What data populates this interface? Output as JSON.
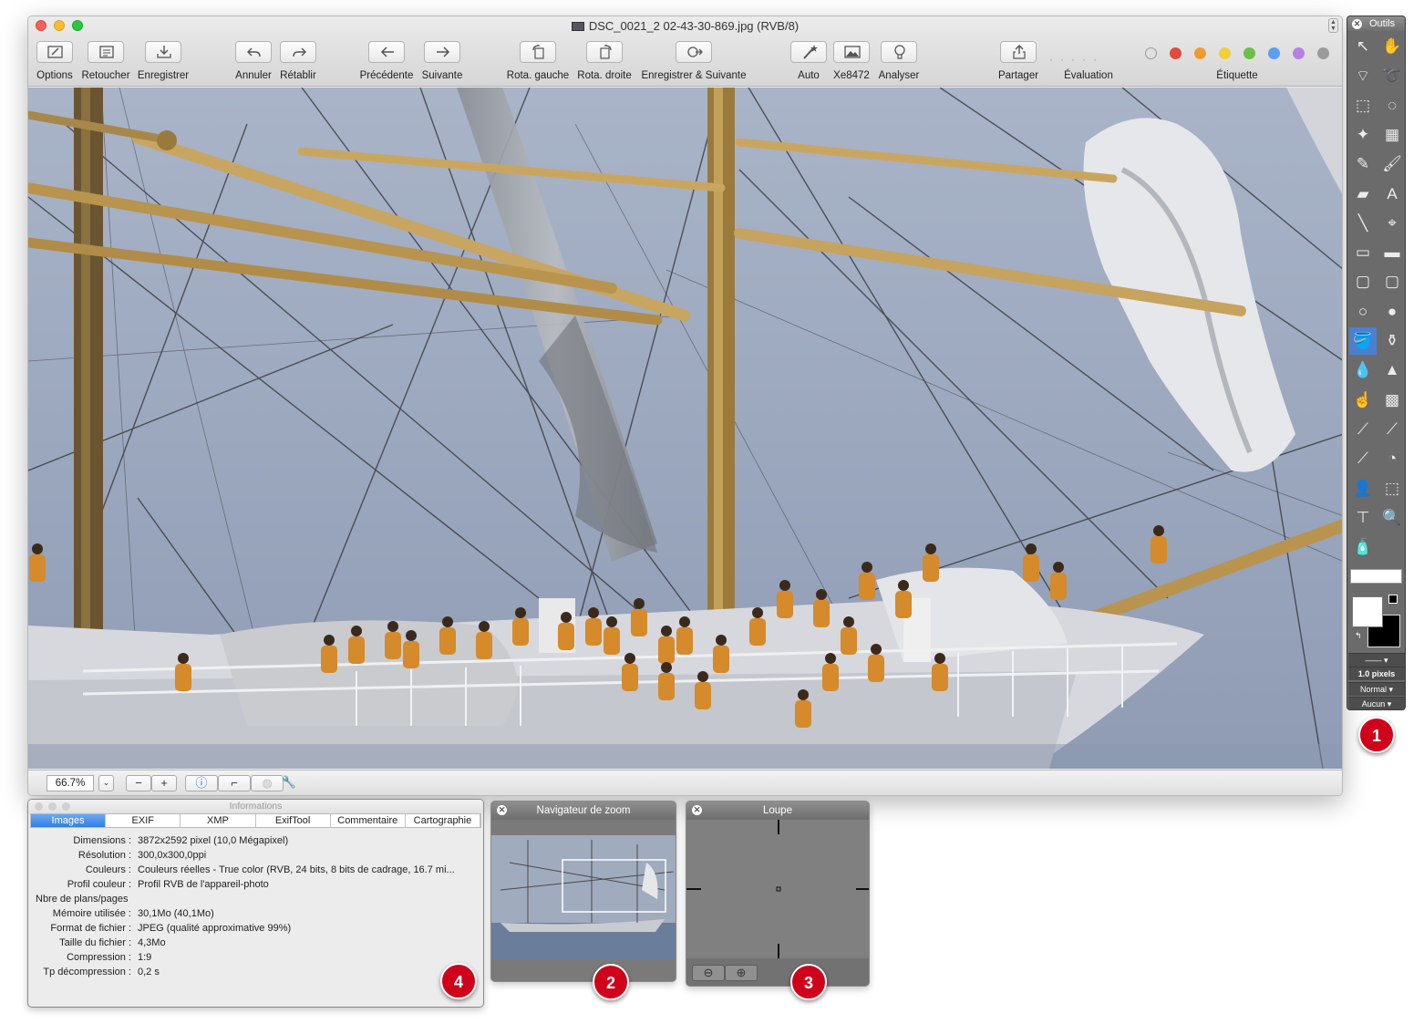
{
  "window": {
    "title": "DSC_0021_2 02-43-30-869.jpg (RVB/8)"
  },
  "toolbar": {
    "options": "Options",
    "retoucher": "Retoucher",
    "enregistrer": "Enregistrer",
    "annuler": "Annuler",
    "retablir": "Rétablir",
    "precedente": "Précédente",
    "suivante": "Suivante",
    "rota_gauche": "Rota. gauche",
    "rota_droite": "Rota. droite",
    "enregistrer_suivante": "Enregistrer & Suivante",
    "auto": "Auto",
    "xe": "Xe8472",
    "analyser": "Analyser",
    "partager": "Partager",
    "evaluation": "Évaluation",
    "etiquette": "Étiquette",
    "label_colors": [
      "#e24b3b",
      "#f09a33",
      "#f0cf3a",
      "#6cc04a",
      "#5b9ff0",
      "#b77fe0",
      "#9b9b9b"
    ]
  },
  "statusbar": {
    "zoom": "66.7%",
    "minus": "−",
    "plus": "+"
  },
  "tools_palette": {
    "title": "Outils",
    "stroke_size": "1.0 pixels",
    "blend_mode": "Normal",
    "texture": "Aucun"
  },
  "info_panel": {
    "title": "Informations",
    "tabs": [
      "Images",
      "EXIF",
      "XMP",
      "ExifTool",
      "Commentaire",
      "Cartographie"
    ],
    "active_tab": "Images",
    "rows": [
      {
        "key": "Dimensions :",
        "value": "3872x2592 pixel (10,0 Mégapixel)"
      },
      {
        "key": "Résolution :",
        "value": "300,0x300,0ppi"
      },
      {
        "key": "Couleurs :",
        "value": "Couleurs réelles - True color (RVB, 24 bits, 8 bits de cadrage, 16.7 mi..."
      },
      {
        "key": "Profil couleur :",
        "value": "Profil RVB de l'appareil-photo"
      },
      {
        "key": "Nbre de plans/pages",
        "value": ""
      },
      {
        "key": "Mémoire utilisée :",
        "value": "30,1Mo (40,1Mo)"
      },
      {
        "key": "Format de fichier :",
        "value": "JPEG (qualité approximative 99%)"
      },
      {
        "key": "Taille du fichier :",
        "value": "4,3Mo"
      },
      {
        "key": "Compression :",
        "value": "1:9"
      },
      {
        "key": "Tp décompression :",
        "value": "0,2 s"
      }
    ]
  },
  "zoom_navigator": {
    "title": "Navigateur de zoom"
  },
  "loupe": {
    "title": "Loupe"
  },
  "badges": [
    "1",
    "2",
    "3",
    "4"
  ]
}
